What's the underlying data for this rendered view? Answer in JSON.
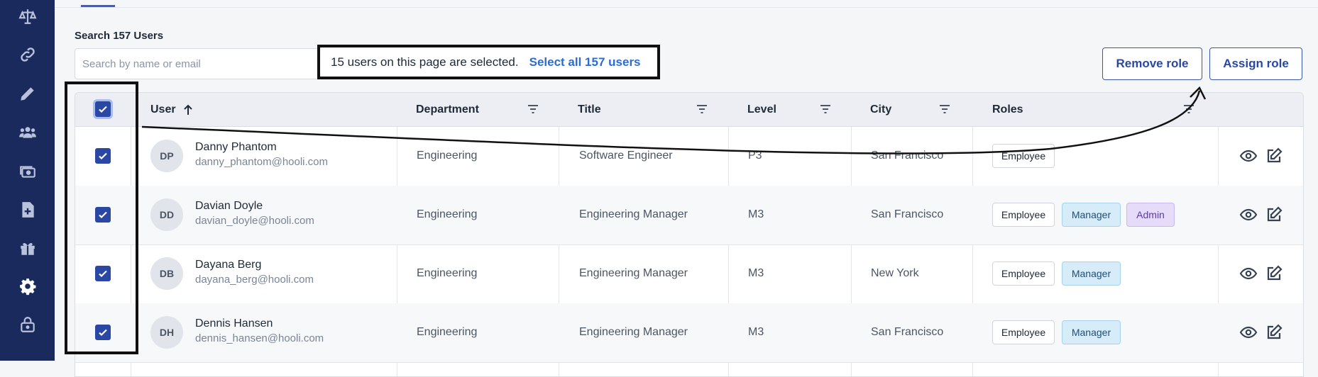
{
  "sidebar": {
    "icons": [
      "scales-icon",
      "link-icon",
      "pencil-icon",
      "people-icon",
      "cards-icon",
      "document-add-icon",
      "gift-icon",
      "gear-icon",
      "lock-icon"
    ]
  },
  "search": {
    "label": "Search 157 Users",
    "placeholder": "Search by name or email"
  },
  "selection": {
    "message": "15 users on this page are selected.",
    "select_all_link": "Select all 157 users"
  },
  "toolbar": {
    "remove_role": "Remove role",
    "assign_role": "Assign role"
  },
  "table": {
    "columns": {
      "user": "User",
      "department": "Department",
      "title": "Title",
      "level": "Level",
      "city": "City",
      "roles": "Roles"
    },
    "sort_icon": "arrow-up-icon",
    "rows": [
      {
        "initials": "DP",
        "name": "Danny Phantom",
        "email": "danny_phantom@hooli.com",
        "department": "Engineering",
        "title": "Software Engineer",
        "level": "P3",
        "city": "San Francisco",
        "roles": [
          "Employee"
        ]
      },
      {
        "initials": "DD",
        "name": "Davian Doyle",
        "email": "davian_doyle@hooli.com",
        "department": "Engineering",
        "title": "Engineering Manager",
        "level": "M3",
        "city": "San Francisco",
        "roles": [
          "Employee",
          "Manager",
          "Admin"
        ]
      },
      {
        "initials": "DB",
        "name": "Dayana Berg",
        "email": "dayana_berg@hooli.com",
        "department": "Engineering",
        "title": "Engineering Manager",
        "level": "M3",
        "city": "New York",
        "roles": [
          "Employee",
          "Manager"
        ]
      },
      {
        "initials": "DH",
        "name": "Dennis Hansen",
        "email": "dennis_hansen@hooli.com",
        "department": "Engineering",
        "title": "Engineering Manager",
        "level": "M3",
        "city": "San Francisco",
        "roles": [
          "Employee",
          "Manager"
        ]
      }
    ]
  },
  "colors": {
    "sidebar": "#1a2a5c",
    "accent": "#2a47a4",
    "link": "#2b6cd3"
  }
}
